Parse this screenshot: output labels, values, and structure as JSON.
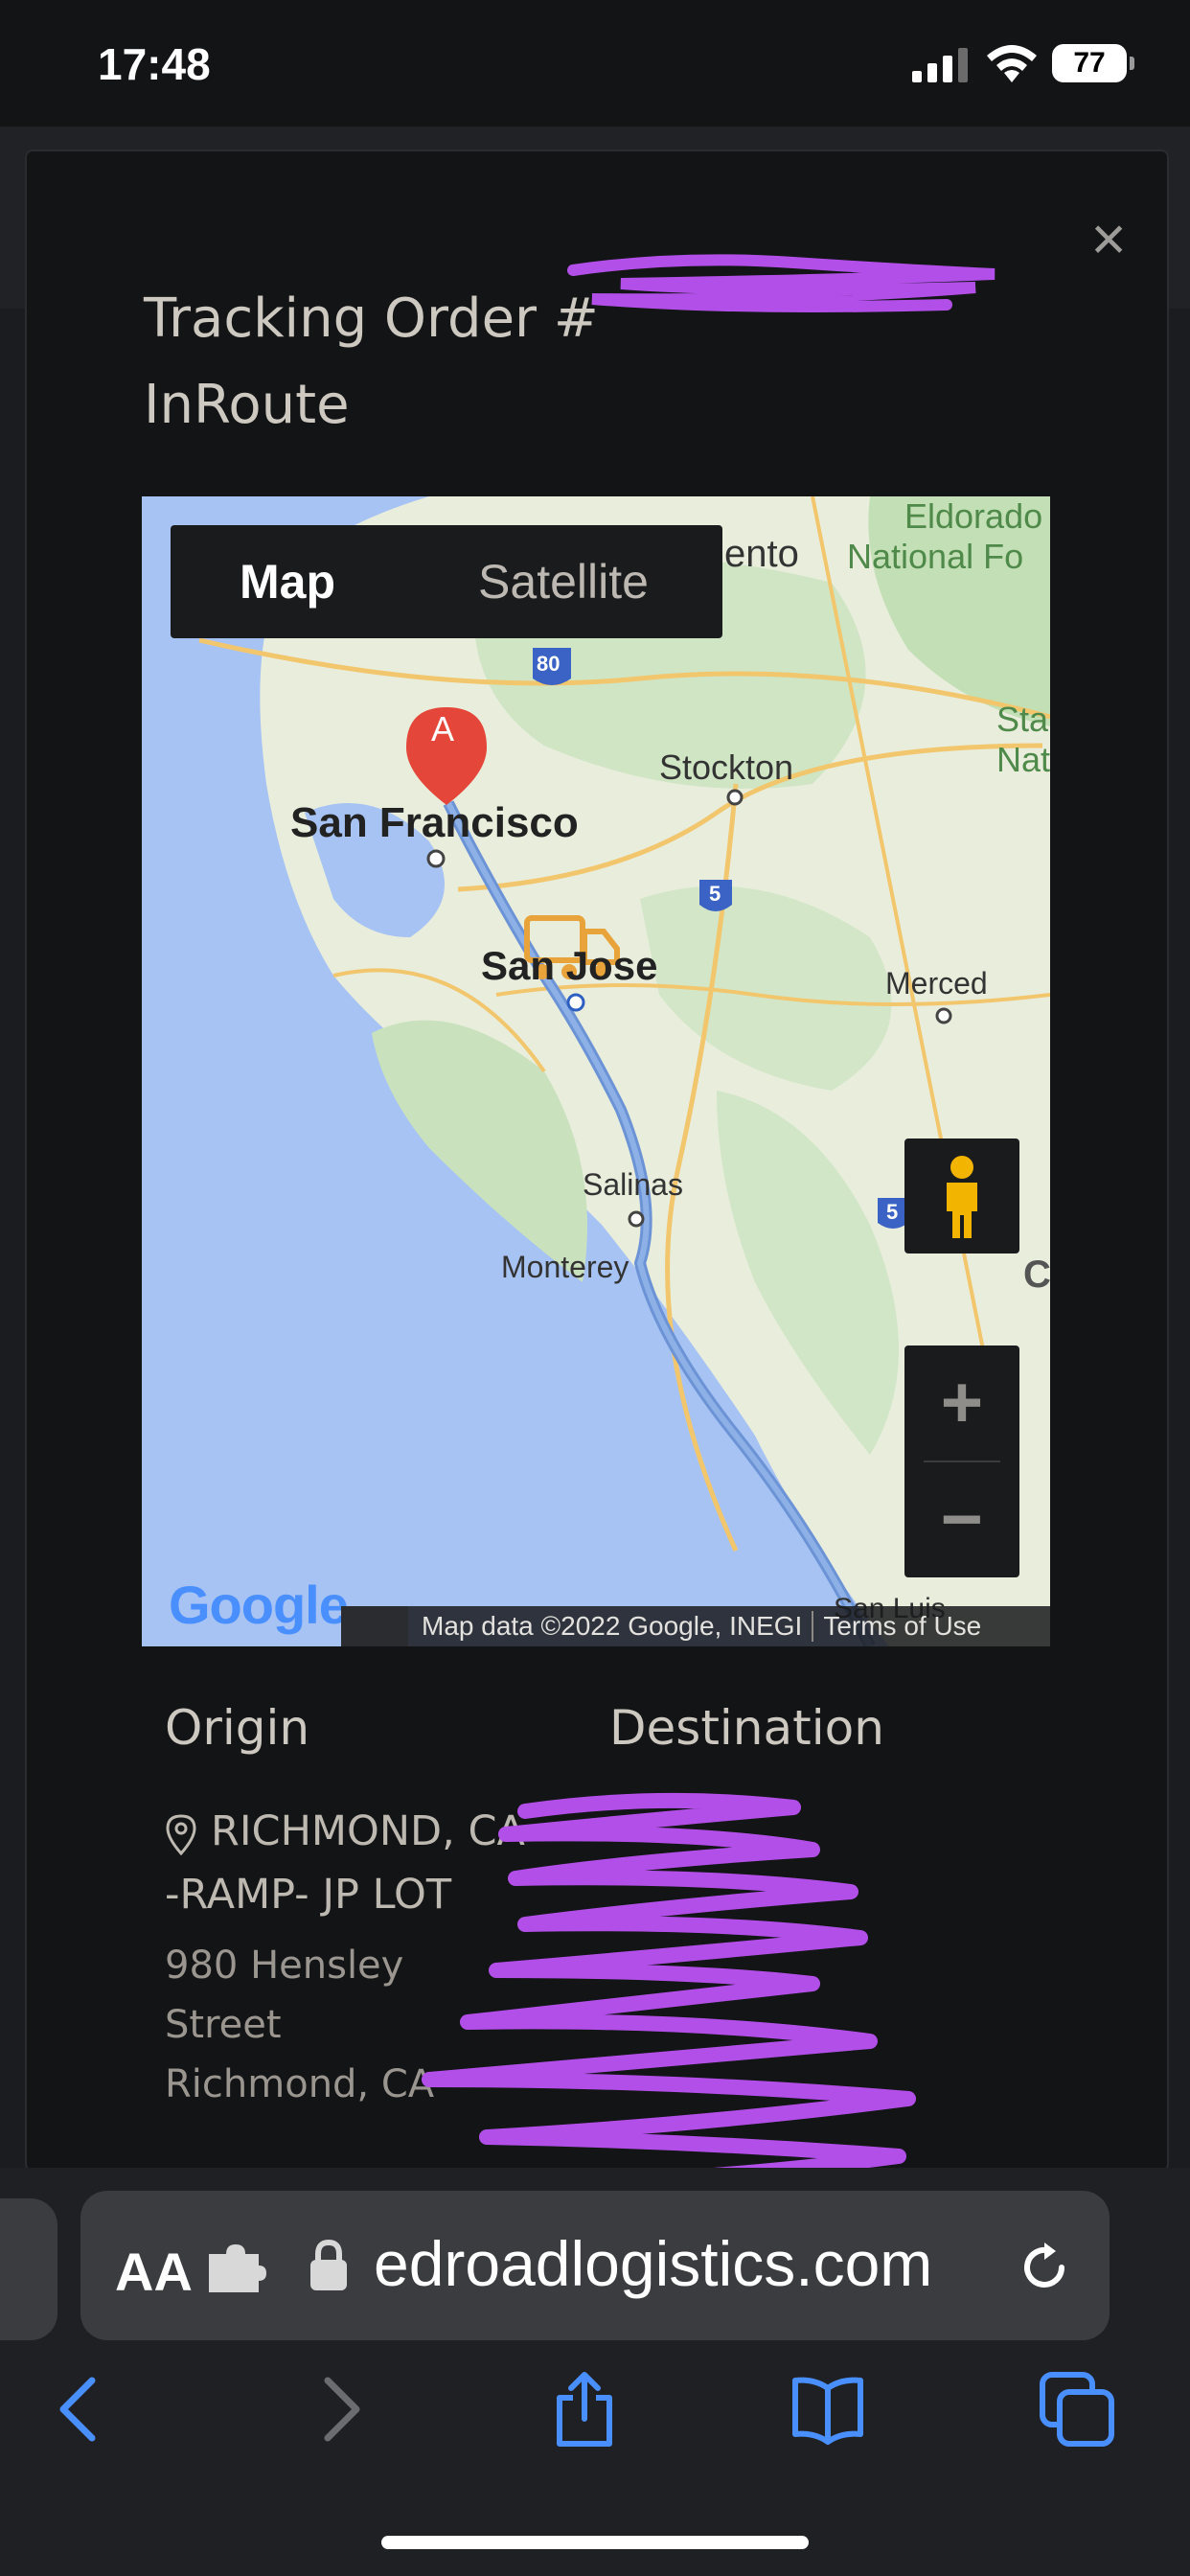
{
  "status_bar": {
    "time": "17:48",
    "battery": "77"
  },
  "modal": {
    "close_symbol": "×",
    "title_line1": "Tracking Order #",
    "title_line2": "InRoute"
  },
  "map": {
    "tabs": [
      {
        "label": "Map",
        "active": true
      },
      {
        "label": "Satellite",
        "active": false
      }
    ],
    "zoom_in": "+",
    "zoom_out": "−",
    "place_labels": [
      "Eldorado",
      "National Fo",
      "ento",
      "Stockton",
      "San Francisco",
      "San Jose",
      "Merced",
      "Salinas",
      "Monterey",
      "San Luis",
      "Sta",
      "Natio",
      "CA"
    ],
    "highway_shields": [
      "80",
      "5",
      "5"
    ],
    "marker_label": "A",
    "google_logo": "Google",
    "attribution": "Map data ©2022 Google, INEGI",
    "terms": "Terms of Use"
  },
  "origin": {
    "heading": "Origin",
    "name": "RICHMOND, CA -RAMP- JP LOT",
    "address_line1": "980 Hensley",
    "address_line2": "Street",
    "address_line3": "Richmond, CA"
  },
  "destination": {
    "heading": "Destination"
  },
  "browser": {
    "aa_label": "AA",
    "url": "edroadlogistics.com"
  },
  "icons": [
    "close-icon",
    "map-pin-icon",
    "truck-icon",
    "pegman-icon",
    "puzzle-icon",
    "lock-icon",
    "reload-icon",
    "back-icon",
    "forward-icon",
    "share-icon",
    "bookmarks-icon",
    "tabs-icon"
  ],
  "colors": {
    "accent_blue": "#4a8fff",
    "marker_red": "#e4473a",
    "truck_orange": "#e8a33a",
    "scribble": "#b24fe8"
  }
}
